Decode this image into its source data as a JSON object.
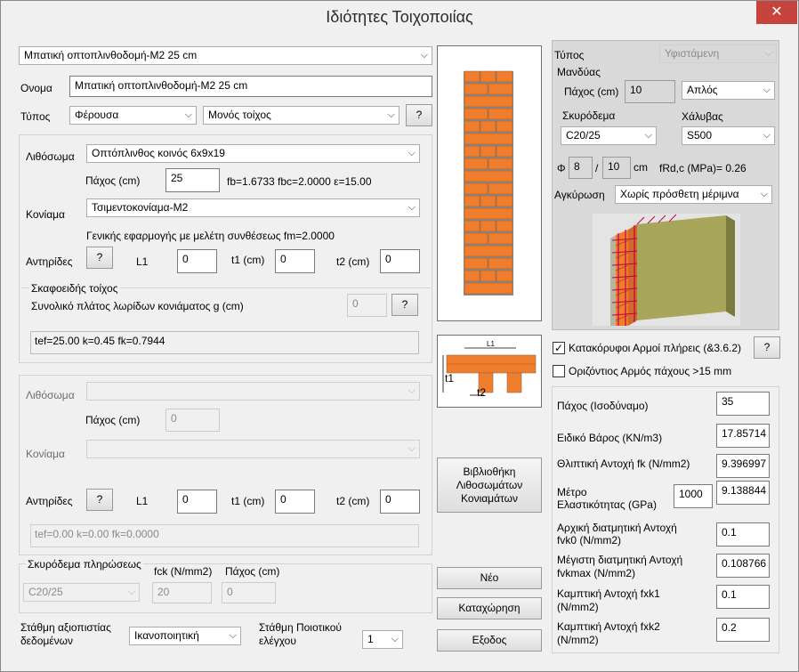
{
  "window": {
    "title": "Ιδιότητες Τοιχοποιίας",
    "close_glyph": "✕"
  },
  "top": {
    "preset_value": "Μπατική οπτοπλινθοδομή-Μ2 25 cm",
    "name_label": "Ονομα",
    "name_value": "Μπατική οπτοπλινθοδομή-Μ2 25 cm",
    "type_label": "Τύπος",
    "type_value": "Φέρουσα",
    "wall_type_value": "Μονός τοίχος",
    "help": "?"
  },
  "layer1": {
    "masonry_unit_label": "Λιθόσωμα",
    "masonry_unit_value": "Οπτόπλινθος κοινός 6x9x19",
    "thickness_label": "Πάχος (cm)",
    "thickness_value": "25",
    "strength_text": "fb=1.6733 fbc=2.0000 ε=15.00",
    "mortar_label": "Κονίαμα",
    "mortar_value": "Τσιμεντοκονίαμα-Μ2",
    "mortar_note": "Γενικής εφαρμογής με μελέτη συνθέσεως fm=2.0000",
    "buttress_label": "Αντηρίδες",
    "l1_label": "L1",
    "l1_value": "0",
    "t1_label": "t1 (cm)",
    "t1_value": "0",
    "t2_label": "t2 (cm)",
    "t2_value": "0",
    "shell_title": "Σκαφοειδής τοίχος",
    "shell_width_label": "Συνολικό πλάτος λωρίδων κονιάματος g (cm)",
    "shell_width_value": "0",
    "result_text": "tef=25.00 k=0.45 fk=0.7944"
  },
  "layer2": {
    "masonry_unit_label": "Λιθόσωμα",
    "masonry_unit_value": "",
    "thickness_label": "Πάχος (cm)",
    "thickness_value": "0",
    "mortar_label": "Κονίαμα",
    "mortar_value": "",
    "buttress_label": "Αντηρίδες",
    "l1_label": "L1",
    "l1_value": "0",
    "t1_label": "t1 (cm)",
    "t1_value": "0",
    "t2_label": "t2 (cm)",
    "t2_value": "0",
    "result_text": "tef=0.00 k=0.00 fk=0.0000"
  },
  "infill": {
    "title": "Σκυρόδεμα πληρώσεως",
    "fck_label": "fck (N/mm2)",
    "thickness_label": "Πάχος (cm)",
    "concrete_value": "C20/25",
    "fck_value": "20",
    "thickness_value": "0"
  },
  "reliability": {
    "data_label_line1": "Στάθμη αξιοπιστίας",
    "data_label_line2": "δεδομένων",
    "data_value": "Ικανοποιητική",
    "quality_label_line1": "Στάθμη Ποιοτικού",
    "quality_label_line2": "ελέγχου",
    "quality_value": "1"
  },
  "diagram": {
    "l1": "L1",
    "t1": "t1",
    "t2": "t2"
  },
  "buttons": {
    "library_line1": "Βιβλιοθήκη",
    "library_line2": "Λιθοσωμάτων",
    "library_line3": "Κονιαμάτων",
    "new": "Νέο",
    "save": "Καταχώρηση",
    "exit": "Εξοδος"
  },
  "jacket": {
    "type_label": "Τύπος",
    "type_value": "Υφιστάμενη",
    "jacket_label": "Μανδύας",
    "thickness_label": "Πάχος (cm)",
    "thickness_value": "10",
    "layout_value": "Απλός",
    "concrete_label": "Σκυρόδεμα",
    "concrete_value": "C20/25",
    "steel_label": "Χάλυβας",
    "steel_value": "S500",
    "phi_label": "Φ",
    "bar_diameter": "8",
    "slash": "/",
    "spacing": "10",
    "cm_unit": "cm",
    "fRd_text": "fRd,c (MPa)=  0.26",
    "anchorage_label": "Αγκύρωση",
    "anchorage_value": "Χωρίς πρόσθετη μέριμνα"
  },
  "checks": {
    "vertical_joints_label": "Κατακόρυφοι Αρμοί πλήρεις (&3.6.2)",
    "vertical_joints_checked": true,
    "horizontal_joint_label": "Οριζόντιος Αρμός πάχους >15 mm",
    "horizontal_joint_checked": false,
    "check_glyph": "✓"
  },
  "properties": {
    "equiv_thickness_label": "Πάχος (Ισοδύναμο)",
    "equiv_thickness_value": "35",
    "unit_weight_label": "Ειδικό Βάρος (KN/m3)",
    "unit_weight_value": "17.85714",
    "fk_label": "Θλιπτική Αντοχή fk (N/mm2)",
    "fk_value": "9.396997",
    "modulus_label_line1": "Μέτρο",
    "modulus_label_line2": "Ελαστικότητας (GPa)",
    "modulus_factor": "1000",
    "modulus_value": "9.138844",
    "fvk0_label_line1": "Αρχική διατμητική Αντοχή",
    "fvk0_label_line2": "fvk0 (N/mm2)",
    "fvk0_value": "0.1",
    "fvkmax_label_line1": "Μέγιστη διατμητική Αντοχή",
    "fvkmax_label_line2": "fvkmax (N/mm2)",
    "fvkmax_value": "0.108766",
    "fxk1_label_line1": "Καμπτική Αντοχή  fxk1",
    "fxk1_label_line2": "(N/mm2)",
    "fxk1_value": "0.1",
    "fxk2_label_line1": "Καμπτική Αντοχή  fxk2",
    "fxk2_label_line2": "(N/mm2)",
    "fxk2_value": "0.2"
  },
  "colors": {
    "brick": "#f07d2c",
    "mortar": "#8c8c8c",
    "close": "#c7433d"
  }
}
